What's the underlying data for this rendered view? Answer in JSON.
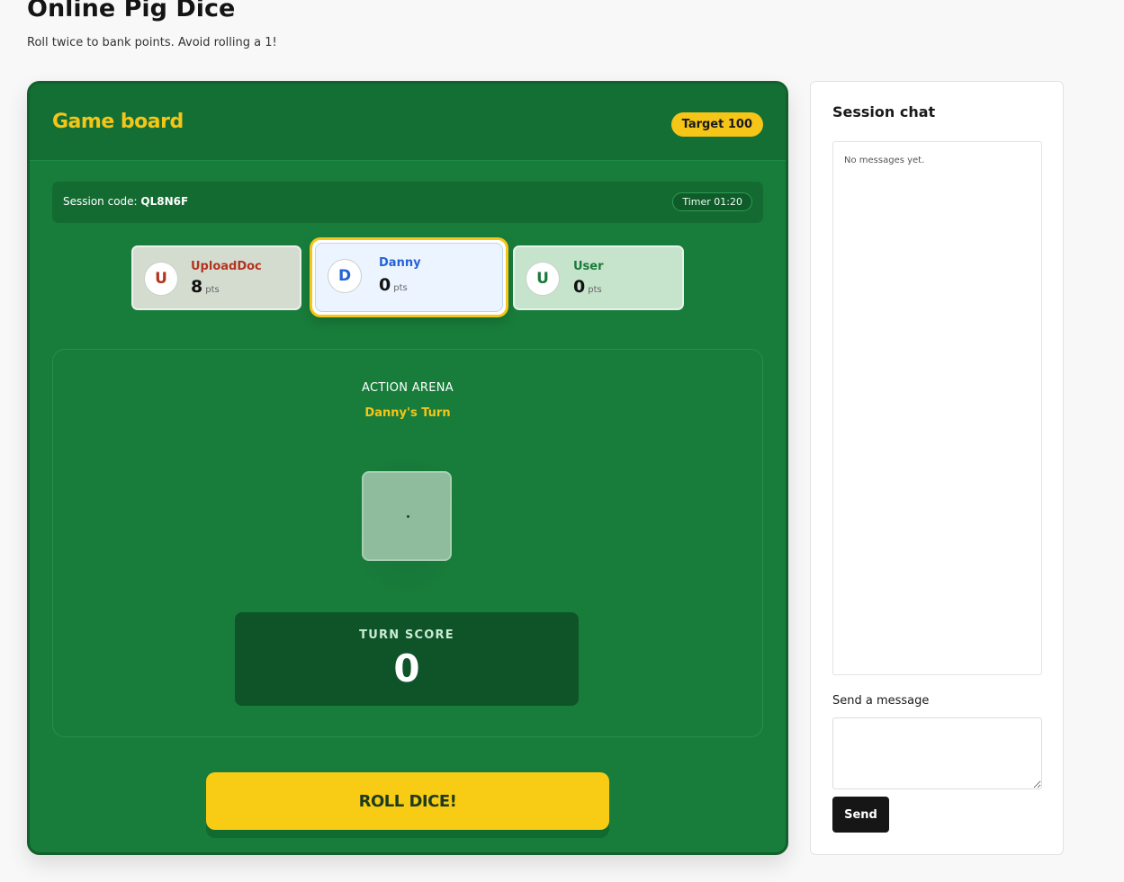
{
  "page": {
    "title": "Online Pig Dice",
    "subtitle": "Roll twice to bank points. Avoid rolling a 1!"
  },
  "board": {
    "title": "Game board",
    "target_label": "Target 100",
    "session_label": "Session code:",
    "session_code": "QL8N6F",
    "timer_label": "Timer 01:20",
    "colors": {
      "background": "#187d3b",
      "accent": "#f5c518"
    }
  },
  "players": [
    {
      "initial": "U",
      "name": "UploadDoc",
      "score": "8",
      "pts_label": "pts",
      "name_color": "#b3341f",
      "active": false
    },
    {
      "initial": "D",
      "name": "Danny",
      "score": "0",
      "pts_label": "pts",
      "name_color": "#2563d6",
      "active": true
    },
    {
      "initial": "U",
      "name": "User",
      "score": "0",
      "pts_label": "pts",
      "name_color": "#1b7a3a",
      "active": false
    }
  ],
  "arena": {
    "title": "ACTION ARENA",
    "turn_label": "Danny's Turn",
    "die_face": "blank",
    "turn_score_label": "TURN SCORE",
    "turn_score_value": "0"
  },
  "actions": {
    "roll_label": "ROLL DICE!"
  },
  "chat": {
    "title": "Session chat",
    "empty_text": "No messages yet.",
    "send_label": "Send a message",
    "input_value": "",
    "send_button": "Send"
  }
}
